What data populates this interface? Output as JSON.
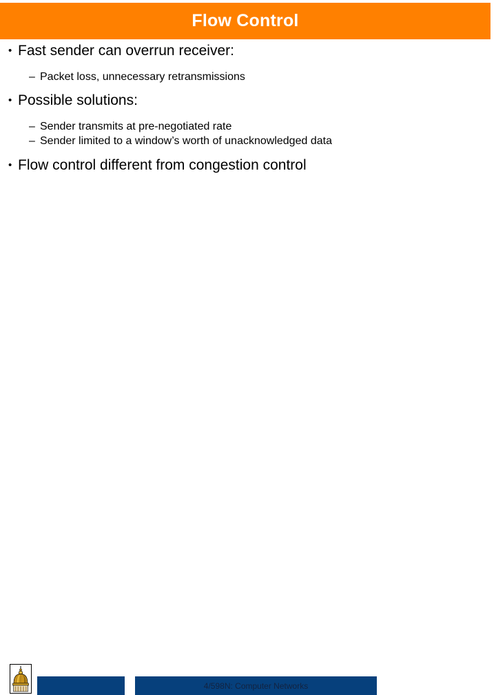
{
  "slide": {
    "title": "Flow Control",
    "title_bg_color": "#ff8000",
    "title_text_color": "#ffffff",
    "background_color": "#ffffff",
    "bullets": [
      {
        "level": 1,
        "marker": "•",
        "text": "Fast sender can overrun receiver:"
      },
      {
        "level": 2,
        "marker": "–",
        "text": "Packet loss, unnecessary retransmissions"
      },
      {
        "level": 1,
        "marker": "•",
        "text": "Possible solutions:"
      },
      {
        "level": 2,
        "marker": "–",
        "text": "Sender transmits at pre-negotiated rate"
      },
      {
        "level": 2,
        "marker": "–",
        "text": "Sender limited to a window’s worth of unacknowledged data"
      },
      {
        "level": 1,
        "marker": "•",
        "text": "Flow control different from congestion control"
      }
    ]
  },
  "footer": {
    "course_text": "4/598N: Computer Networks",
    "bar_color": "#06407c",
    "logo_name": "golden-dome-logo",
    "logo_colors": {
      "dome": "#c8921c",
      "dome_highlight": "#e8b93a",
      "dome_shadow": "#8a6310",
      "outline": "#000000"
    }
  }
}
